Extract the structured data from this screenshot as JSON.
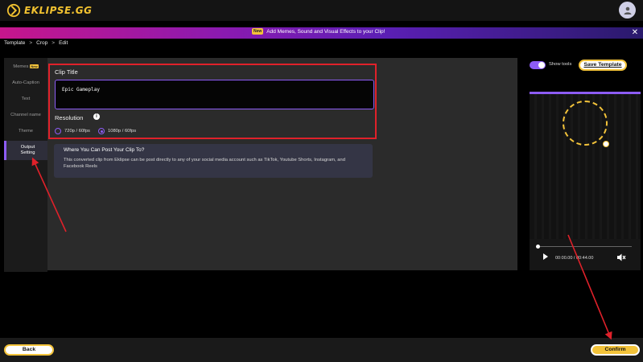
{
  "app": {
    "logo_text": "EKLIPSE.GG"
  },
  "banner": {
    "badge": "New",
    "text": "Add Memes, Sound and Visual Effects to your Clip!"
  },
  "breadcrumb": [
    "Template",
    "Crop",
    "Edit"
  ],
  "sidebar": {
    "items": [
      {
        "label": "Memes",
        "badge": "New"
      },
      {
        "label": "Auto-Caption"
      },
      {
        "label": "Text"
      },
      {
        "label": "Channel name"
      },
      {
        "label": "Theme"
      },
      {
        "label": "Output Setting",
        "active": true
      }
    ]
  },
  "settings": {
    "clip_title_label": "Clip Title",
    "clip_title_value": "Epic Gameplay",
    "resolution_label": "Resolution",
    "resolution_options": [
      {
        "label": "720p / 60fps",
        "selected": false
      },
      {
        "label": "1080p / 60fps",
        "selected": true
      }
    ]
  },
  "info_card": {
    "title": "Where You Can Post Your Clip To?",
    "body": "This converted clip from Eklipse can be post directly to any of your social media account such as TikTok, Youtube Shorts, Instagram, and Facebook Reels"
  },
  "preview": {
    "show_tools_label": "Show tools",
    "show_tools_on": true,
    "save_template_label": "Save Template",
    "time": "00:00.00 / 00:44.00",
    "playback_progress": 0.0
  },
  "footer": {
    "back_label": "Back",
    "confirm_label": "Confirm"
  },
  "colors": {
    "accent": "#8d5cf6",
    "brand_yellow": "#f3c33a",
    "highlight_red": "#e0212a"
  }
}
